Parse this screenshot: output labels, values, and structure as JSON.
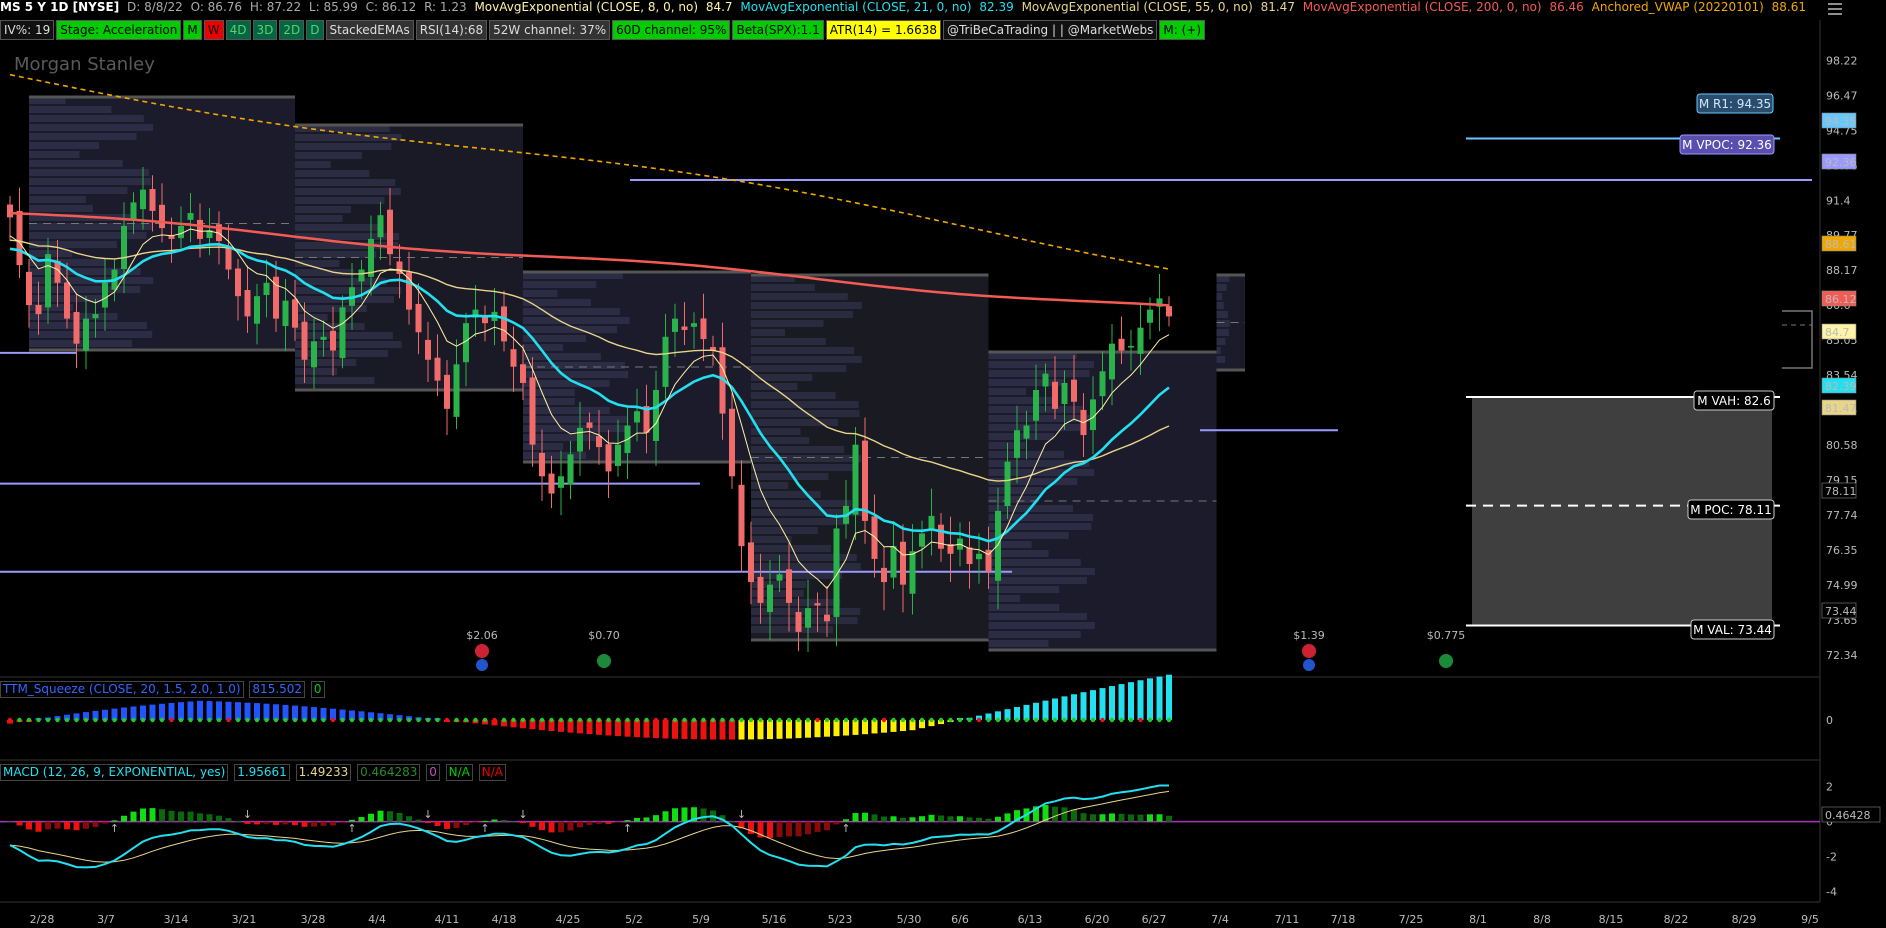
{
  "header": {
    "symbol": "MS 5 Y 1D [NYSE]",
    "date": "D: 8/8/22",
    "open": "O: 86.76",
    "high": "H: 87.22",
    "low": "L: 85.99",
    "close": "C: 86.12",
    "range": "R: 1.23",
    "ema8_label": "MovAvgExponential (CLOSE, 8, 0, no)",
    "ema8_val": "84.7",
    "ema21_label": "MovAvgExponential (CLOSE, 21, 0, no)",
    "ema21_val": "82.39",
    "ema55_label": "MovAvgExponential (CLOSE, 55, 0, no)",
    "ema55_val": "81.47",
    "ema200_label": "MovAvgExponential (CLOSE, 200, 0, no)",
    "ema200_val": "86.46",
    "vwap_label": "Anchored_VWAP (20220101)",
    "vwap_val": "88.61"
  },
  "studies": [
    {
      "text": "IV%: 19",
      "style": "st-white"
    },
    {
      "text": "Stage: Acceleration",
      "style": "st-green"
    },
    {
      "text": "M",
      "style": "st-green"
    },
    {
      "text": "W",
      "style": "st-red"
    },
    {
      "text": "4D",
      "style": "st-dgreen"
    },
    {
      "text": "3D",
      "style": "st-dgreen"
    },
    {
      "text": "2D",
      "style": "st-dgreen"
    },
    {
      "text": "D",
      "style": "st-dgreen"
    },
    {
      "text": "StackedEMAs",
      "style": "st-grey"
    },
    {
      "text": "RSI(14):68",
      "style": "st-grey"
    },
    {
      "text": "52W channel: 37%",
      "style": "st-grey"
    },
    {
      "text": "60D channel: 95%",
      "style": "st-green"
    },
    {
      "text": "Beta(SPX):1.1",
      "style": "st-green"
    },
    {
      "text": "ATR(14) = 1.6638",
      "style": "st-yellow"
    },
    {
      "text": "@TriBeCaTrading | | @MarketWebs",
      "style": "st-white"
    },
    {
      "text": "M: (+)",
      "style": "st-green"
    }
  ],
  "watermark": "Morgan Stanley",
  "colors": {
    "ema8": "#fff3a8",
    "ema21": "#22e0f0",
    "ema55": "#e8d58a",
    "ema200": "#f25c54",
    "vwap": "#f0a800",
    "up": "#29b34a",
    "down": "#f26b6b",
    "level": "#9999ff",
    "r1": "#66c8ff"
  },
  "chart_data": [
    {
      "type": "candlestick",
      "panel": "price",
      "title": "MS 5 Y 1D [NYSE]",
      "x_labels": [
        "2/28",
        "3/7",
        "3/14",
        "3/21",
        "3/28",
        "4/4",
        "4/11",
        "4/18",
        "4/25",
        "5/2",
        "5/9",
        "5/16",
        "5/23",
        "5/30",
        "6/6",
        "6/13",
        "6/20",
        "6/27",
        "7/4",
        "7/11",
        "7/18",
        "7/25",
        "8/1",
        "8/8",
        "8/15",
        "8/22",
        "8/29",
        "9/5"
      ],
      "y_ticks": [
        "98.22",
        "96.47",
        "94.75",
        "93.06",
        "91.4",
        "89.77",
        "88.17",
        "86.6",
        "85.05",
        "83.54",
        "82.05",
        "80.58",
        "79.15",
        "77.74",
        "76.35",
        "74.99",
        "73.65",
        "72.34"
      ],
      "ylim": [
        72.0,
        99.0
      ],
      "y_scale": "log",
      "series": [
        {
          "name": "Close",
          "values": [
            90.6,
            88.4,
            86.6,
            86.2,
            88.9,
            87.6,
            86.0,
            84.9,
            86.0,
            86.2,
            87.6,
            88.2,
            90.2,
            91.3,
            91.9,
            90.9,
            90.1,
            89.6,
            90.2,
            90.8,
            89.6,
            90.0,
            89.5,
            88.2,
            87.0,
            86.1,
            87.0,
            87.6,
            86.0,
            86.8,
            85.6,
            84.2,
            85.0,
            85.2,
            84.6,
            86.5,
            87.4,
            88.2,
            89.6,
            90.7,
            88.9,
            88.0,
            86.4,
            85.4,
            84.2,
            83.3,
            82.1,
            84.0,
            85.8,
            86.4,
            85.8,
            86.3,
            85.0,
            83.9,
            83.2,
            80.6,
            79.3,
            78.6,
            79.3,
            80.2,
            81.3,
            81.3,
            80.5,
            79.5,
            80.6,
            81.4,
            82.0,
            81.1,
            82.9,
            85.2,
            86.0,
            85.5,
            85.8,
            85.1,
            84.6,
            81.9,
            79.3,
            76.5,
            75.1,
            74.3,
            75.0,
            75.4,
            74.3,
            73.2,
            74.1,
            74.2,
            73.6,
            77.2,
            78.1,
            80.6,
            77.5,
            76.0,
            75.1,
            76.5,
            75.0,
            76.3,
            77.0,
            77.7,
            76.4,
            76.2,
            76.8,
            75.8,
            76.2,
            75.5,
            77.9,
            79.9,
            81.2,
            81.4,
            82.9,
            83.6,
            82.1,
            83.2,
            82.4,
            81.0,
            82.5,
            83.7,
            84.9,
            84.6,
            84.8,
            85.6,
            86.4,
            86.9,
            86.1
          ]
        },
        {
          "name": "EMA 8",
          "last": 84.7
        },
        {
          "name": "EMA 21",
          "last": 82.39
        },
        {
          "name": "EMA 55",
          "last": 81.47
        },
        {
          "name": "EMA 200",
          "last": 86.46
        },
        {
          "name": "Anchored VWAP",
          "last": 88.61
        }
      ],
      "levels": [
        {
          "label": "M R1: 94.35",
          "value": 94.35
        },
        {
          "label": "M VPOC: 92.36",
          "value": 92.36
        },
        {
          "label": "M VAH: 82.6",
          "value": 82.6
        },
        {
          "label": "M POC: 78.11",
          "value": 78.11
        },
        {
          "label": "M VAL: 73.44",
          "value": 73.44
        }
      ],
      "price_tags": [
        {
          "value": 94.35,
          "text": "94.35"
        },
        {
          "value": 92.36,
          "text": "92.36"
        },
        {
          "value": 88.61,
          "text": "88.61"
        },
        {
          "value": 86.12,
          "text": "86.12"
        },
        {
          "value": 84.7,
          "text": "84.7"
        },
        {
          "value": 82.39,
          "text": "82.39"
        },
        {
          "value": 81.47,
          "text": "81.47"
        },
        {
          "value": 78.11,
          "text": "78.11"
        },
        {
          "value": 73.44,
          "text": "73.44"
        }
      ],
      "events": [
        {
          "label": "$2.06"
        },
        {
          "label": "$0.70"
        },
        {
          "label": "$1.39"
        },
        {
          "label": "$0.775"
        }
      ]
    },
    {
      "type": "bar",
      "panel": "ttm_squeeze",
      "title": "TTM_Squeeze (CLOSE, 20, 1.5, 2.0, 1.0)",
      "y_ticks": [
        "0"
      ]
    },
    {
      "type": "bar+line",
      "panel": "macd",
      "title": "MACD (12, 26, 9, EXPONENTIAL, yes)",
      "y_ticks": [
        "2",
        "0",
        "-2",
        "-4"
      ],
      "ylim": [
        -4.5,
        2.5
      ],
      "series": [
        {
          "name": "Value",
          "last": 1.95661
        },
        {
          "name": "Avg",
          "last": 1.49233
        },
        {
          "name": "Diff",
          "last": 0.464283
        }
      ]
    }
  ],
  "ttm": {
    "label": "TTM_Squeeze (CLOSE, 20, 1.5, 2.0, 1.0)",
    "val1": "815.502",
    "val2": "0",
    "zero": "0"
  },
  "macd": {
    "label": "MACD (12, 26, 9, EXPONENTIAL, yes)",
    "value": "1.95661",
    "avg": "1.49233",
    "diff": "0.464283",
    "v0": "0",
    "na1": "N/A",
    "na2": "N/A",
    "tag": "0.46428"
  }
}
